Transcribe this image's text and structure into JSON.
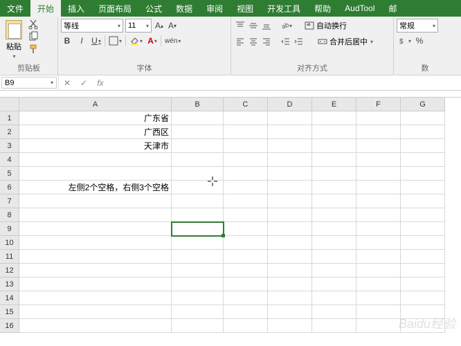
{
  "tabs": [
    "文件",
    "开始",
    "插入",
    "页面布局",
    "公式",
    "数据",
    "审阅",
    "视图",
    "开发工具",
    "帮助",
    "AudTool",
    "邮"
  ],
  "active_tab": 1,
  "ribbon": {
    "clipboard": {
      "paste": "粘贴",
      "label": "剪贴板"
    },
    "font": {
      "name": "等线",
      "size": "11",
      "bold": "B",
      "italic": "I",
      "underline": "U",
      "wen": "wén",
      "label": "字体"
    },
    "alignment": {
      "wrap_ab": "ab",
      "wrap": "自动换行",
      "merge": "合并后居中",
      "label": "对齐方式"
    },
    "number": {
      "format": "常规",
      "label": "数"
    }
  },
  "name_box": "B9",
  "fx_label": "fx",
  "columns": [
    "A",
    "B",
    "C",
    "D",
    "E",
    "F",
    "G"
  ],
  "col_widths": [
    "col-A",
    "col-B",
    "col-C",
    "col-D",
    "col-E",
    "col-F",
    "col-G"
  ],
  "rows": [
    "1",
    "2",
    "3",
    "4",
    "5",
    "6",
    "7",
    "8",
    "9",
    "10",
    "11",
    "12",
    "13",
    "14",
    "15",
    "16"
  ],
  "cells": {
    "A1": "广东省",
    "A2": "广西区",
    "A3": "天津市",
    "A6": "左侧2个空格，右侧3个空格"
  },
  "selected": "B9",
  "watermark": "Baidu经验"
}
